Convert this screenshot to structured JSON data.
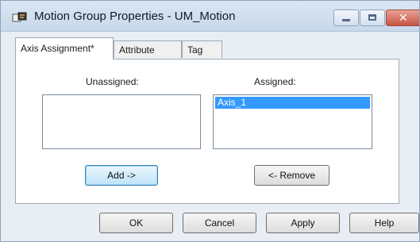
{
  "window": {
    "title": "Motion Group Properties - UM_Motion",
    "close_glyph": "✕"
  },
  "tabs": [
    {
      "label": "Axis Assignment*",
      "active": true
    },
    {
      "label": "Attribute",
      "active": false
    },
    {
      "label": "Tag",
      "active": false
    }
  ],
  "axis_assignment": {
    "unassigned_label": "Unassigned:",
    "assigned_label": "Assigned:",
    "unassigned_items": [],
    "assigned_items": [
      "Axis_1"
    ],
    "add_button": "Add ->",
    "remove_button": "<- Remove"
  },
  "dialog_buttons": {
    "ok": "OK",
    "cancel": "Cancel",
    "apply": "Apply",
    "help": "Help"
  },
  "colors": {
    "selection": "#3399ff",
    "title_bar": "#c8d8ea",
    "close_button": "#c65342"
  },
  "icons": [
    "motion-group-icon",
    "minimize-icon",
    "maximize-icon",
    "close-icon"
  ]
}
